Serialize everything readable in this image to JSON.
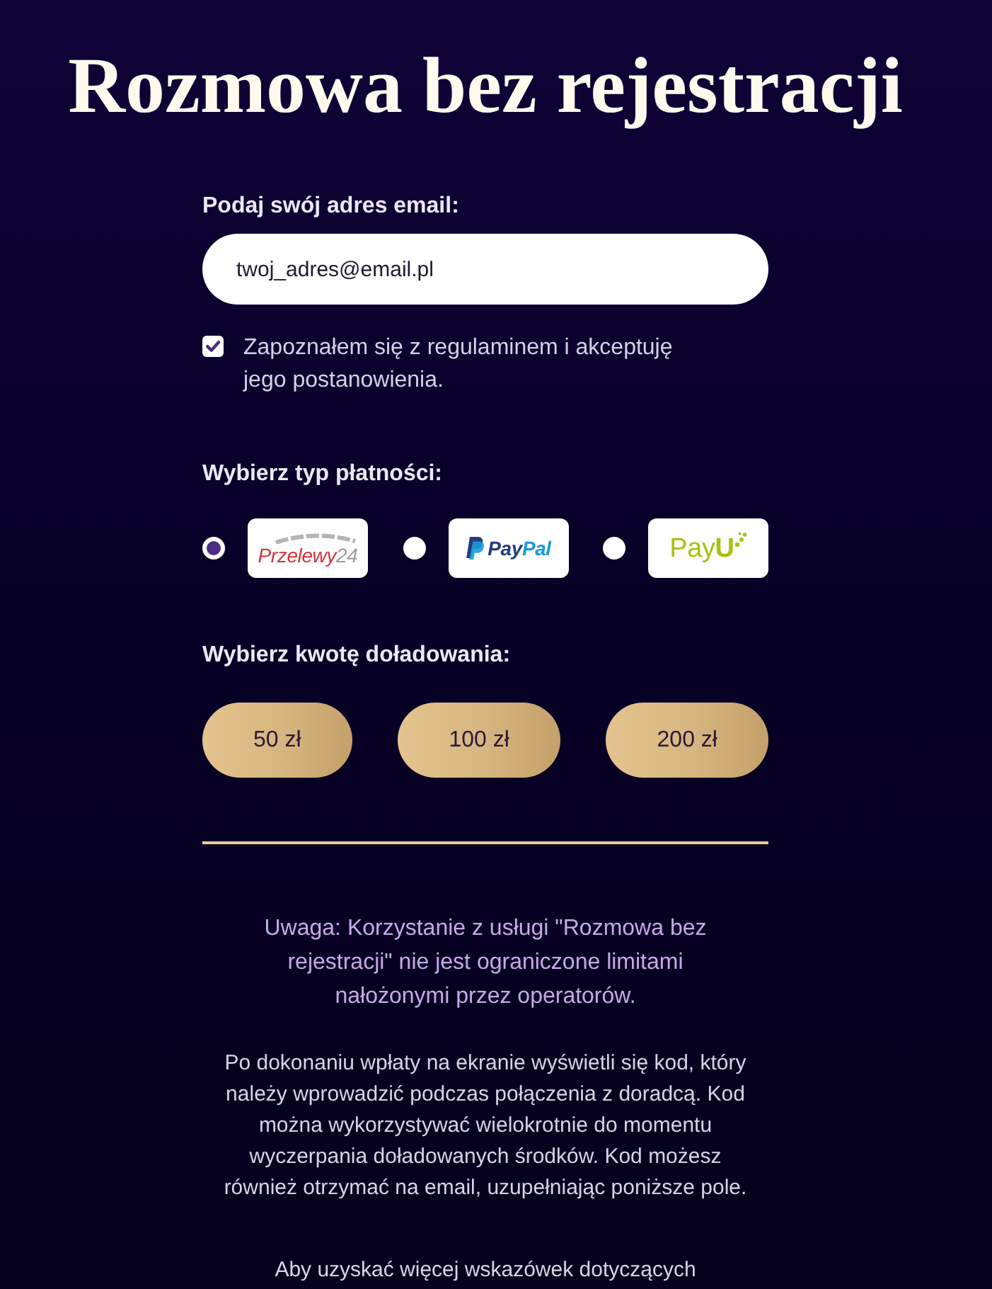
{
  "title": "Rozmowa bez rejestracji",
  "email": {
    "label": "Podaj swój adres email:",
    "placeholder": "twoj_adres@email.pl"
  },
  "consent": {
    "checked": true,
    "text": "Zapoznałem się z regulaminem i akceptuję jego postanowienia."
  },
  "payment": {
    "label": "Wybierz typ płatności:",
    "options": [
      {
        "kind": "przelewy24",
        "selected": true,
        "logo_parts": [
          "Przelewy",
          "24"
        ]
      },
      {
        "kind": "paypal",
        "selected": false,
        "logo_parts": [
          "Pay",
          "Pal"
        ]
      },
      {
        "kind": "payu",
        "selected": false,
        "logo_parts": [
          "Pay",
          "U"
        ]
      }
    ]
  },
  "amount": {
    "label": "Wybierz kwotę doładowania:",
    "options": [
      "50 zł",
      "100 zł",
      "200 zł"
    ]
  },
  "notice": "Uwaga: Korzystanie z usługi \"Rozmowa bez rejestracji\" nie jest ograniczone limitami nałożonymi przez operatorów.",
  "info": "Po dokonaniu wpłaty na ekranie wyświetli się kod, który należy wprowadzić podczas połączenia z doradcą. Kod można wykorzystywać wielokrotnie do momentu wyczerpania doładowanych środków. Kod możesz również otrzymać na email, uzupełniając poniższe pole.",
  "more": "Aby uzyskać więcej wskazówek dotyczących"
}
